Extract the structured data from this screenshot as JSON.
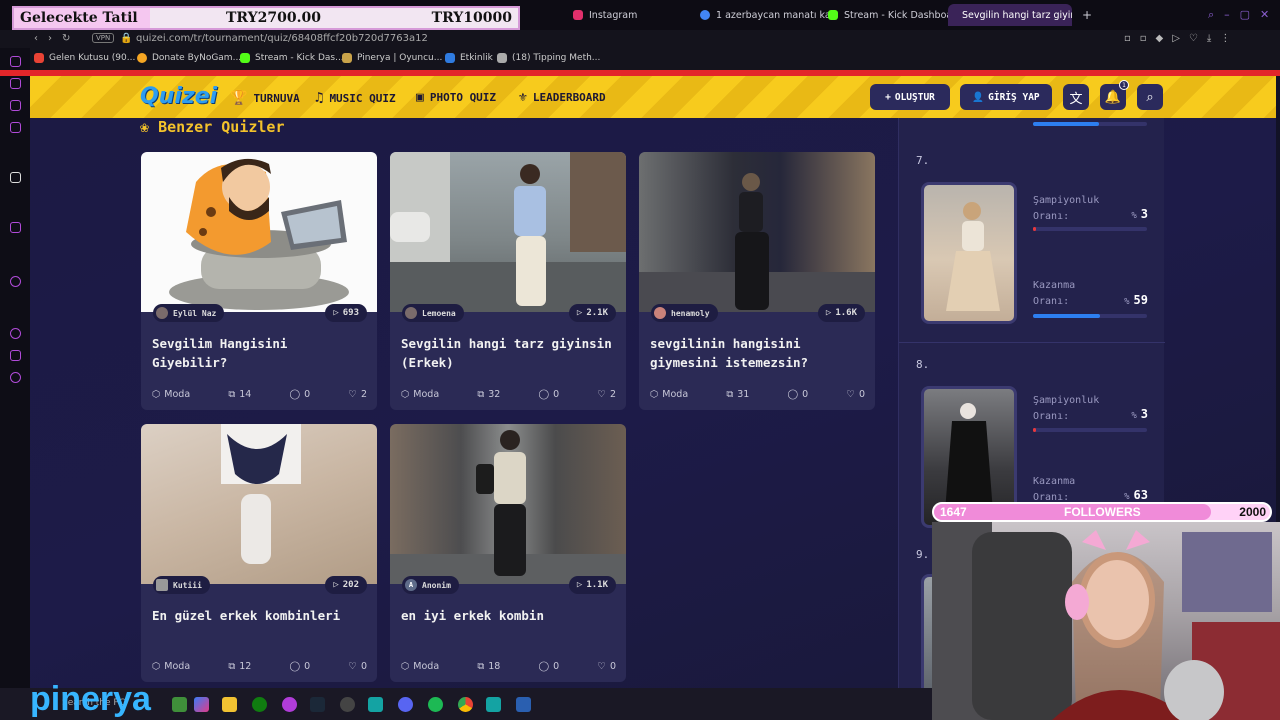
{
  "overlay": {
    "label": "Gelecekte Tatil",
    "current": "TRY2700.00",
    "goal": "TRY10000"
  },
  "browser": {
    "tabs": [
      {
        "label": "Instagram",
        "color": "#e1306c"
      },
      {
        "label": "1 azerbaycan manatı kaç",
        "color": "#4285f4"
      },
      {
        "label": "Stream - Kick Dashboard",
        "color": "#53fc18"
      },
      {
        "label": "Sevgilin hangi tarz giyinsi",
        "color": "#f3c22b"
      }
    ],
    "vpn": "VPN",
    "url": "quizei.com/tr/tournament/quiz/68408ffcf20b720d7763a12",
    "bookmarks": [
      "Gelen Kutusu (90...",
      "Donate ByNoGam...",
      "Stream - Kick Das...",
      "Pinerya | Oyuncu...",
      "Etkinlik",
      "(18) Tipping Meth..."
    ]
  },
  "header": {
    "logo": "Quizei",
    "nav": [
      "TURNUVA",
      "MUSIC QUIZ",
      "PHOTO QUIZ",
      "LEADERBOARD"
    ],
    "create": "OLUŞTUR",
    "login": "GİRİŞ YAP",
    "notif_count": "1"
  },
  "section_title": "Benzer Quizler",
  "cards": [
    {
      "author": "Eylül Naz",
      "plays": "693",
      "title": "Sevgilim Hangisini Giyebilir?",
      "category": "Moda",
      "items": "14",
      "comments": "0",
      "likes": "2",
      "thumb": "caveman"
    },
    {
      "author": "Lemoena",
      "plays": "2.1K",
      "title": "Sevgilin hangi tarz giyinsin (Erkek)",
      "category": "Moda",
      "items": "32",
      "comments": "0",
      "likes": "2",
      "thumb": "street-man"
    },
    {
      "author": "henamoly",
      "plays": "1.6K",
      "title": "sevgilinin hangisini giymesini istemezsin?",
      "category": "Moda",
      "items": "31",
      "comments": "0",
      "likes": "0",
      "thumb": "night-woman"
    },
    {
      "author": "Kutiii",
      "plays": "202",
      "title": "En güzel erkek kombinleri",
      "category": "Moda",
      "items": "12",
      "comments": "0",
      "likes": "0",
      "thumb": "sweater"
    },
    {
      "author": "Anonim",
      "plays": "1.1K",
      "title": "en iyi erkek kombin",
      "category": "Moda",
      "items": "18",
      "comments": "0",
      "likes": "0",
      "thumb": "bag-man"
    }
  ],
  "ranking": [
    {
      "rank": "7.",
      "champ_label": "Şampiyonluk Oranı:",
      "champ": "3",
      "win_label": "Kazanma Oranı:",
      "win": "59",
      "champ_pct": 3,
      "win_pct": 59
    },
    {
      "rank": "8.",
      "champ_label": "Şampiyonluk Oranı:",
      "champ": "3",
      "win_label": "Kazanma Oranı:",
      "win": "63",
      "champ_pct": 3,
      "win_pct": 63
    },
    {
      "rank": "9."
    }
  ],
  "pct_symbol": "%",
  "followers": {
    "current": "1647",
    "label": "FOLLOWERS",
    "goal": "2000",
    "ratio": 0.8235
  },
  "taskbar": {
    "brand": "pinerya",
    "search_hint": "Search the PC"
  },
  "colors": {
    "accent": "#f3c22b",
    "win_bar": "#2d7ff0",
    "champ_bar": "#e8383d"
  }
}
